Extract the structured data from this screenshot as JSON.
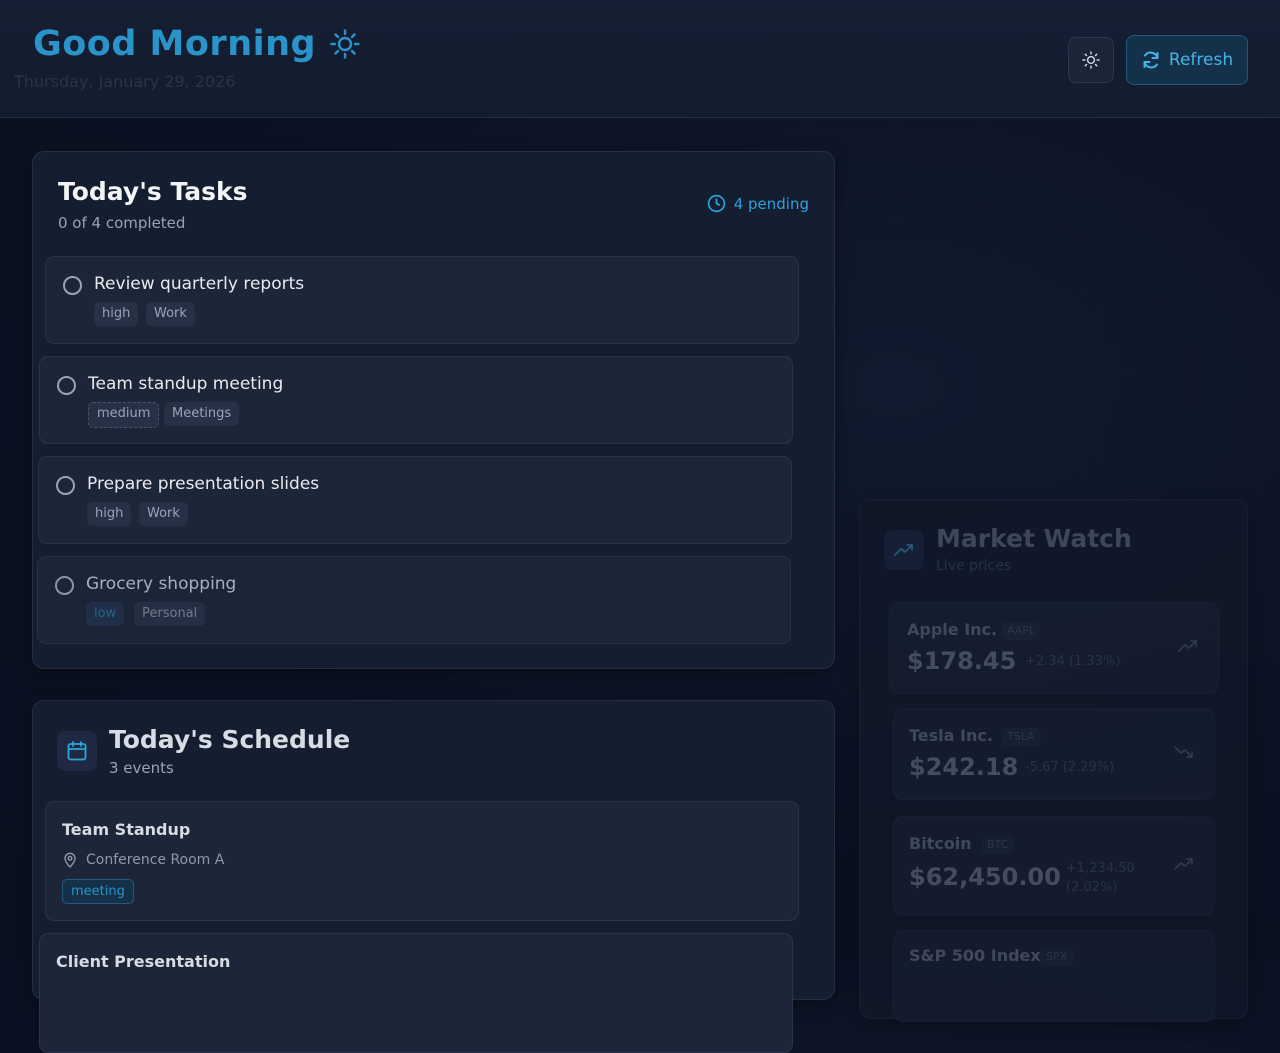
{
  "header": {
    "greeting": "Good Morning",
    "date": "Thursday, January 29, 2026",
    "refresh_label": "Refresh"
  },
  "tasks": {
    "title": "Today's Tasks",
    "subtitle": "0 of 4 completed",
    "pending_label": "4 pending",
    "items": [
      {
        "title": "Review quarterly reports",
        "priority": "high",
        "category": "Work"
      },
      {
        "title": "Team standup meeting",
        "priority": "medium",
        "category": "Meetings"
      },
      {
        "title": "Prepare presentation slides",
        "priority": "high",
        "category": "Work"
      },
      {
        "title": "Grocery shopping",
        "priority": "low",
        "category": "Personal"
      }
    ]
  },
  "schedule": {
    "title": "Today's Schedule",
    "subtitle": "3 events",
    "events": [
      {
        "title": "Team Standup",
        "location": "Conference Room A",
        "type": "meeting"
      },
      {
        "title": "Client Presentation"
      }
    ]
  },
  "market": {
    "title": "Market Watch",
    "subtitle": "Live prices",
    "stocks": [
      {
        "name": "Apple Inc.",
        "symbol": "AAPL",
        "price": "$178.45",
        "change": "+2.34 (1.33%)",
        "trend": "up"
      },
      {
        "name": "Tesla Inc.",
        "symbol": "TSLA",
        "price": "$242.18",
        "change": "-5.67 (2.29%)",
        "trend": "down"
      },
      {
        "name": "Bitcoin",
        "symbol": "BTC",
        "price": "$62,450.00",
        "change_line1": "+1,234.50",
        "change_line2": "(2.02%)",
        "trend": "up"
      },
      {
        "name": "S&P 500 Index",
        "symbol": "SPX"
      }
    ]
  },
  "colors": {
    "accent": "#2a93c9",
    "background": "#0b1122",
    "card": "#151d30"
  }
}
